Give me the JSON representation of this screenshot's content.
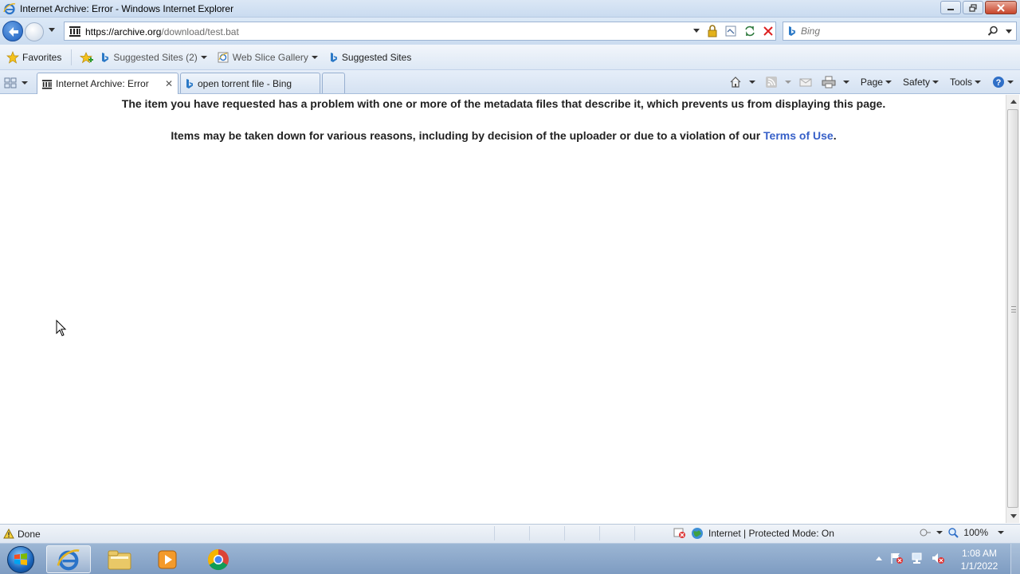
{
  "window": {
    "title": "Internet Archive: Error - Windows Internet Explorer"
  },
  "navigation": {
    "url_host": "https://archive.org",
    "url_path": "/download/test.bat",
    "search_placeholder": "Bing"
  },
  "favorites_bar": {
    "favorites_label": "Favorites",
    "items": [
      {
        "label": "Suggested Sites (2)",
        "icon": "bing-icon"
      },
      {
        "label": "Web Slice Gallery",
        "icon": "ie-page-icon"
      },
      {
        "label": "Suggested Sites",
        "icon": "bing-icon"
      }
    ]
  },
  "tabs": [
    {
      "label": "Internet Archive: Error",
      "active": true
    },
    {
      "label": "open torrent file - Bing",
      "active": false
    }
  ],
  "command_bar": {
    "page_label": "Page",
    "safety_label": "Safety",
    "tools_label": "Tools"
  },
  "page": {
    "message_1": "The item you have requested has a problem with one or more of the metadata files that describe it, which prevents us from displaying this page.",
    "message_2_prefix": "Items may be taken down for various reasons, including by decision of the uploader or due to a violation of our ",
    "terms_link": "Terms of Use",
    "message_2_suffix": "."
  },
  "status_bar": {
    "status": "Done",
    "zone": "Internet | Protected Mode: On",
    "zoom": "100%"
  },
  "taskbar": {
    "time": "1:08 AM",
    "date": "1/1/2022"
  },
  "colors": {
    "link": "#3760c8",
    "chrome_blue": "#cbdcf0",
    "close_red": "#c7452b"
  }
}
